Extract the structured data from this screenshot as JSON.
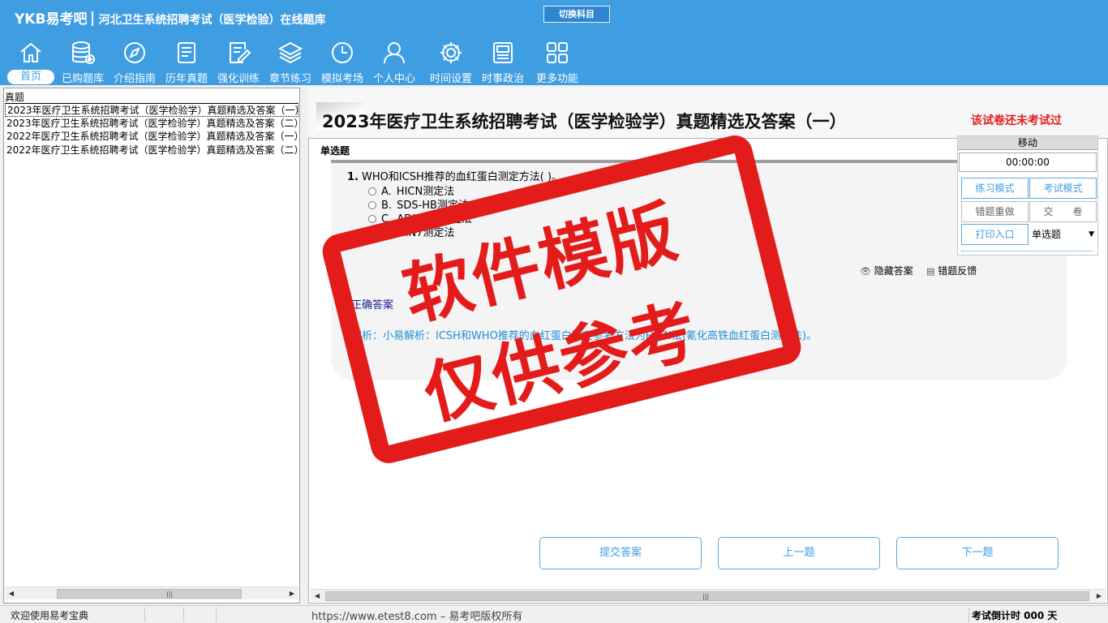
{
  "header": {
    "brand": "YKB易考吧",
    "title": "河北卫生系统招聘考试（医学检验）在线题库",
    "switch_subject": "切换科目"
  },
  "nav": [
    {
      "label": "首页",
      "icon": "home-icon"
    },
    {
      "label": "已购题库",
      "icon": "database-icon"
    },
    {
      "label": "介绍指南",
      "icon": "compass-icon"
    },
    {
      "label": "历年真题",
      "icon": "list-doc-icon"
    },
    {
      "label": "强化训练",
      "icon": "edit-doc-icon"
    },
    {
      "label": "章节练习",
      "icon": "layers-icon"
    },
    {
      "label": "模拟考场",
      "icon": "clock-icon"
    },
    {
      "label": "个人中心",
      "icon": "user-icon"
    },
    {
      "label": "时间设置",
      "icon": "gear-icon"
    },
    {
      "label": "时事政治",
      "icon": "newspaper-icon"
    },
    {
      "label": "更多功能",
      "icon": "grid-icon"
    }
  ],
  "tree": {
    "root": "真题",
    "items": [
      "2023年医疗卫生系统招聘考试（医学检验学）真题精选及答案（一）",
      "2023年医疗卫生系统招聘考试（医学检验学）真题精选及答案（二）",
      "2022年医疗卫生系统招聘考试（医学检验学）真题精选及答案（一）",
      "2022年医疗卫生系统招聘考试（医学检验学）真题精选及答案（二）"
    ]
  },
  "paper": {
    "title": "2023年医疗卫生系统招聘考试（医学检验学）真题精选及答案（一）",
    "status": "该试卷还未考试过"
  },
  "question": {
    "type": "单选题",
    "number": "1.",
    "stem": "WHO和ICSH推荐的血红蛋白测定方法( )。",
    "options": [
      {
        "letter": "A.",
        "text": "HICN测定法"
      },
      {
        "letter": "B.",
        "text": "SDS-HB测定法"
      },
      {
        "letter": "C.",
        "text": "ADH575测定法"
      },
      {
        "letter": "D.",
        "text": "HiN7测定法"
      }
    ],
    "hide_answer": "隐藏答案",
    "feedback": "错题反馈",
    "answer_label": "正确答案",
    "analysis": "解析：小易解析：ICSH和WHO推荐的血红蛋白测定参考方法为HiCN法(氰化高铁血红蛋白测定法)。"
  },
  "buttons": {
    "submit": "提交答案",
    "prev": "上一题",
    "next": "下一题"
  },
  "side_panel": {
    "move": "移动",
    "timer": "00:00:00",
    "practice_mode": "练习模式",
    "exam_mode": "考试模式",
    "redo_wrong": "错题重做",
    "hand_in": "交　　卷",
    "print": "打印入口",
    "type_select": "单选题"
  },
  "watermark": {
    "line1": "软件模版",
    "line2": "仅供参考"
  },
  "status": {
    "welcome": "欢迎使用易考宝典",
    "url": "https://www.etest8.com – 易考吧版权所有",
    "countdown": "考试倒计时 000 天"
  }
}
